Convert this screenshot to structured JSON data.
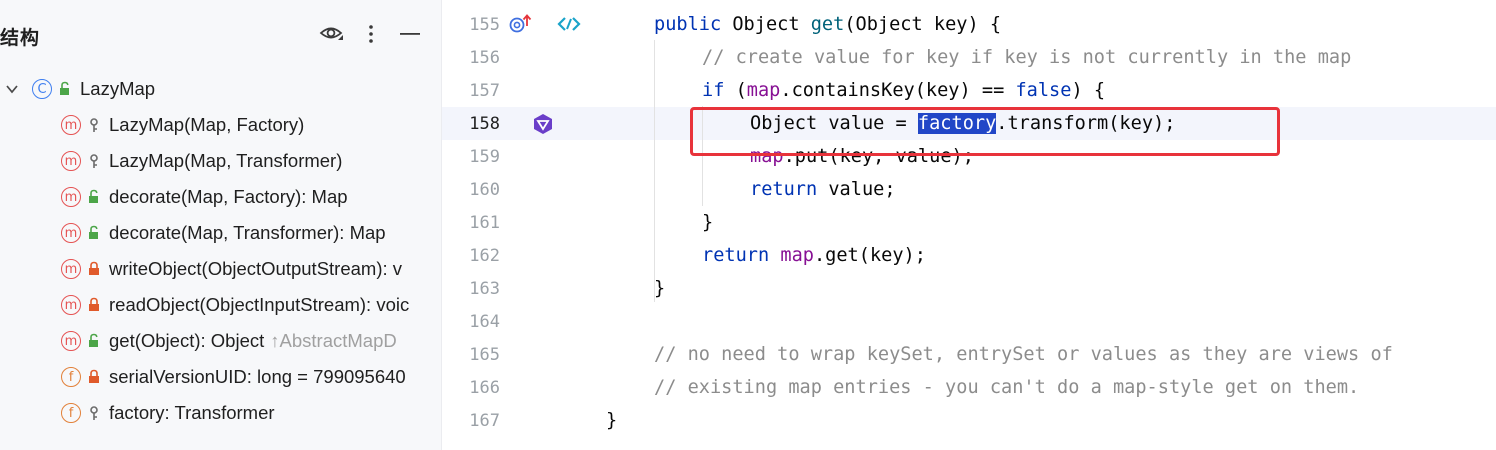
{
  "structure_panel": {
    "title": "结构",
    "buttons": {
      "view_options": "eye-icon",
      "more": "more-vertical-icon",
      "minimize": "minimize-icon"
    },
    "tree": [
      {
        "kind": "c",
        "kind_letter": "C",
        "visibility": "public",
        "label": "LazyMap",
        "inherited": ""
      },
      {
        "kind": "m",
        "kind_letter": "m",
        "visibility": "protected",
        "label": "LazyMap(Map, Factory)",
        "inherited": ""
      },
      {
        "kind": "m",
        "kind_letter": "m",
        "visibility": "protected",
        "label": "LazyMap(Map, Transformer)",
        "inherited": ""
      },
      {
        "kind": "m",
        "kind_letter": "m",
        "visibility": "public",
        "label": "decorate(Map, Factory): Map",
        "inherited": ""
      },
      {
        "kind": "m",
        "kind_letter": "m",
        "visibility": "public",
        "label": "decorate(Map, Transformer): Map",
        "inherited": ""
      },
      {
        "kind": "m",
        "kind_letter": "m",
        "visibility": "private",
        "label": "writeObject(ObjectOutputStream): v",
        "inherited": ""
      },
      {
        "kind": "m",
        "kind_letter": "m",
        "visibility": "private",
        "label": "readObject(ObjectInputStream): voic",
        "inherited": ""
      },
      {
        "kind": "m",
        "kind_letter": "m",
        "visibility": "public",
        "label": "get(Object): Object",
        "inherited": "↑AbstractMapD"
      },
      {
        "kind": "f",
        "kind_letter": "f",
        "visibility": "private",
        "label": "serialVersionUID: long = 799095640",
        "inherited": ""
      },
      {
        "kind": "f",
        "kind_letter": "f",
        "visibility": "protected",
        "label": "factory: Transformer",
        "inherited": ""
      }
    ]
  },
  "editor": {
    "lines": [
      {
        "num": "155",
        "text": "public Object get(Object key) {"
      },
      {
        "num": "156",
        "text": "// create value for key if key is not currently in the map"
      },
      {
        "num": "157",
        "text": "if (map.containsKey(key) == false) {"
      },
      {
        "num": "158",
        "text": "Object value = factory.transform(key);"
      },
      {
        "num": "159",
        "text": "map.put(key, value);"
      },
      {
        "num": "160",
        "text": "return value;"
      },
      {
        "num": "161",
        "text": "}"
      },
      {
        "num": "162",
        "text": "return map.get(key);"
      },
      {
        "num": "163",
        "text": "}"
      },
      {
        "num": "164",
        "text": ""
      },
      {
        "num": "165",
        "text": "// no need to wrap keySet, entrySet or values as they are views of"
      },
      {
        "num": "166",
        "text": "// existing map entries - you can't do a map-style get on them."
      },
      {
        "num": "167",
        "text": "}"
      }
    ],
    "tokens": {
      "l155": [
        "public",
        " Object ",
        "get",
        "(Object key) {"
      ],
      "l156": [
        "// create value for key if key is not currently in the map"
      ],
      "l157": [
        "if",
        " (",
        "map",
        ".containsKey(key) == ",
        "false",
        ") {"
      ],
      "l158": [
        "Object value = ",
        "factory",
        ".transform(key);"
      ],
      "l159": [
        "map",
        ".put(key, value);"
      ],
      "l160": [
        "return",
        " value;"
      ],
      "l161": [
        "}"
      ],
      "l162": [
        "return",
        " ",
        "map",
        ".get(key);"
      ],
      "l163": [
        "}"
      ],
      "l165": [
        "// no need to wrap keySet, entrySet or values as they are views of"
      ],
      "l166": [
        "// existing map entries - you can't do a map-style get on them."
      ],
      "l167": [
        "}"
      ]
    },
    "selected_word": "factory",
    "gutter_icons": {
      "155": [
        "override-up-icon",
        "lambda-link-icon"
      ],
      "158": [
        "debug-marker-icon"
      ]
    },
    "colors": {
      "keyword": "#0033b3",
      "comment": "#8c8c8c",
      "field": "#871094",
      "selection": "#2146c7",
      "annotation_box": "#e8333b"
    }
  }
}
